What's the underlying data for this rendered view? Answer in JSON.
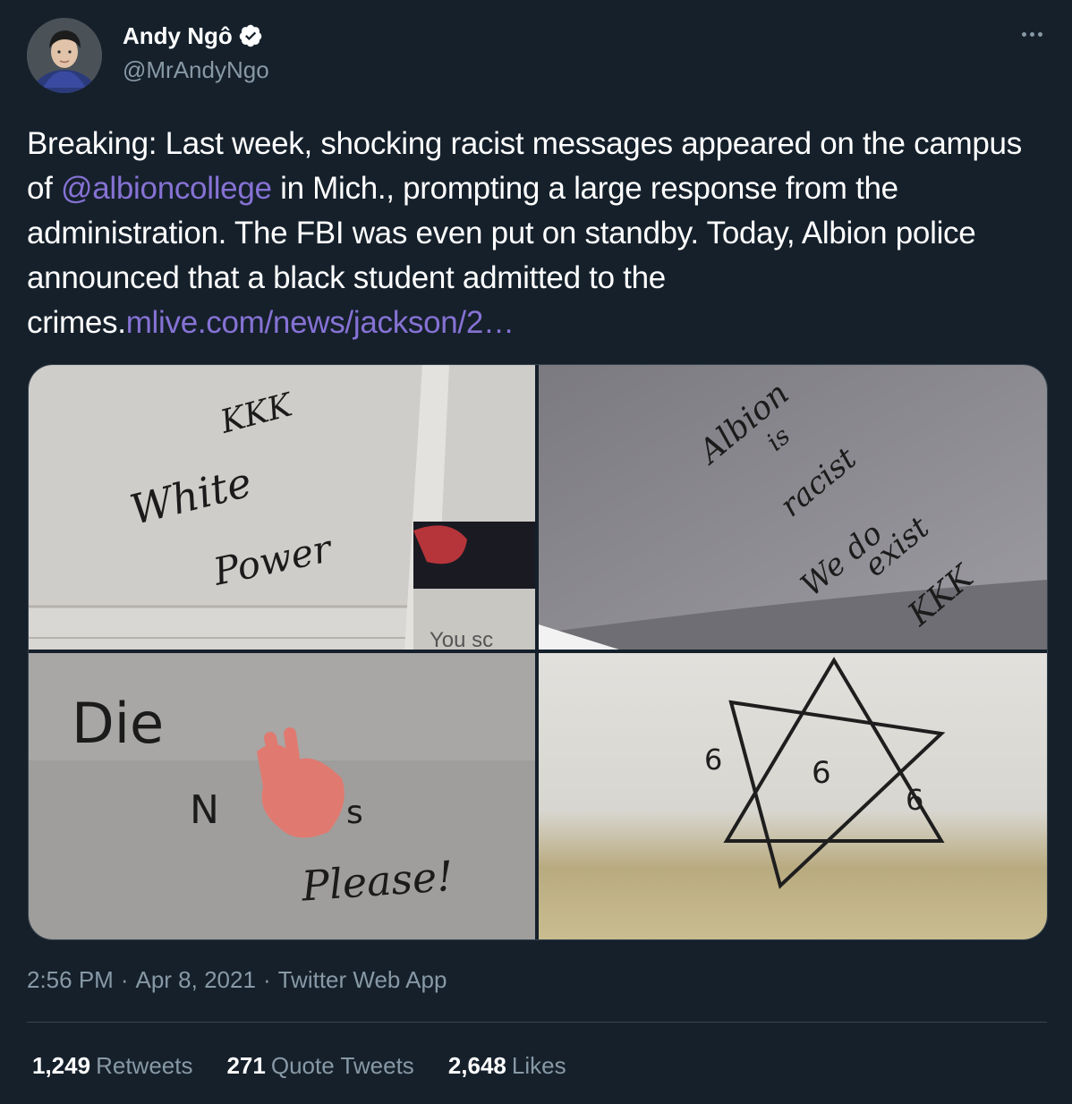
{
  "author": {
    "display_name": "Andy Ngô",
    "handle": "@MrAndyNgo",
    "verified": true
  },
  "tweet": {
    "text_before_mention": "Breaking: Last week, shocking racist messages appeared on the campus of ",
    "mention": "@albioncollege",
    "text_after_mention": " in Mich., prompting a large response from the administration. The FBI was even put on standby. Today, Albion police announced that a black student admitted to the crimes.",
    "link": "mlive.com/news/jackson/2…"
  },
  "media": {
    "top_left_text": [
      "KKK",
      "White",
      "Power"
    ],
    "top_left_poster": "You sc",
    "top_right_text": [
      "Albion",
      "is",
      "racist",
      "We do",
      "exist",
      "KKK"
    ],
    "bottom_left_text": [
      "Die",
      "N",
      "s",
      "Please!"
    ],
    "bottom_right_text": [
      "6",
      "6",
      "6"
    ]
  },
  "meta": {
    "time": "2:56 PM",
    "separator": "·",
    "date": "Apr 8, 2021",
    "source": "Twitter Web App"
  },
  "stats": {
    "retweets": {
      "count": "1,249",
      "label": "Retweets"
    },
    "quotes": {
      "count": "271",
      "label": "Quote Tweets"
    },
    "likes": {
      "count": "2,648",
      "label": "Likes"
    }
  },
  "colors": {
    "background": "#15202b",
    "link": "#8672d4",
    "secondary_text": "#8899a6",
    "verified_badge": "#ffffff"
  },
  "icons": [
    "verified-badge-icon",
    "more-options-icon"
  ]
}
